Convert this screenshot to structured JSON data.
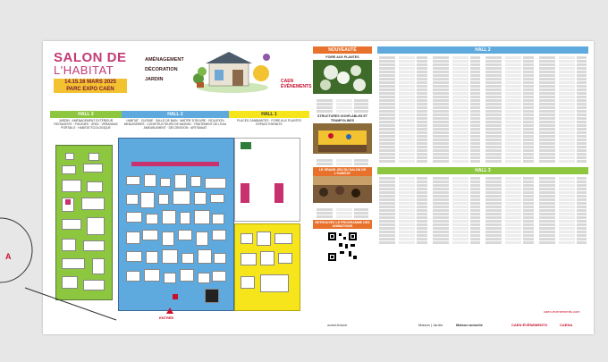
{
  "header": {
    "title_line1": "SALON DE",
    "title_line2": "L'HABITAT",
    "dates": "14.15.16 MARS 2025",
    "venue": "PARC EXPO CAEN",
    "themes": [
      "AMÉNAGEMENT",
      "DÉCORATION",
      "JARDIN"
    ],
    "organizer_logo": [
      "CAEN",
      "ÉVÉNEMENTS"
    ]
  },
  "map": {
    "hall3": {
      "label": "HALL 3",
      "desc": [
        "JARDIN · AMÉNAGEMENT EXTÉRIEUR",
        "PAYSAGISTE · PISCINES · SPAS · VÉRANDAS",
        "PORTAILS · HABITAT ÉCOLOGIQUE"
      ]
    },
    "hall2": {
      "label": "HALL 2",
      "desc": [
        "HABITAT · CUISINE · SALLE DE BAIN · MAÎTRE D'ŒUVRE · ISOLATION",
        "MENUISERIES · CONSTRUCTEURS DE MAISON · TRAITEMENT DE L'EAU",
        "AMEUBLEMENT · DÉCORATION · ARTISANAT"
      ]
    },
    "hall1": {
      "label": "HALL 1",
      "desc": [
        "PLACES CAMBIANTES · FOIRE AUX PLANTES",
        "ESPACE ENFANTS"
      ]
    },
    "entree": "ENTRÉE"
  },
  "center_col": {
    "head": "NOUVEAUTÉ",
    "sub1": "FOIRE AUX PLANTES",
    "sub2": "STRUCTURES GONFLABLES ET TRAMPOLINES",
    "jeu": "LE GRAND JEU DU SALON DE L'HABITAT",
    "programme": "RETROUVEZ LE PROGRAMME DES ANIMATIONS"
  },
  "lists": {
    "hall2": "HALL 2",
    "hall3": "HALL 3"
  },
  "footer": {
    "partners": [
      "ouest-france",
      "Maison | Jardin",
      "Maison actuelle",
      "CAEN ÉVÉNEMENTS",
      "CAENA"
    ],
    "social": "caen-evenements.com"
  },
  "colors": {
    "green": "#8dc63f",
    "blue": "#5ea9dd",
    "yellow": "#f5e51a",
    "orange": "#e8712c",
    "magenta": "#c23a75"
  }
}
